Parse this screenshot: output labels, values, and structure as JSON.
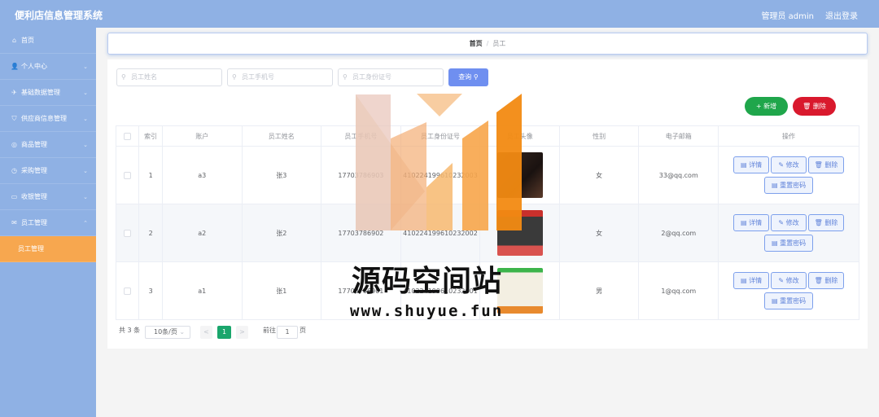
{
  "app": {
    "title": "便利店信息管理系统",
    "user_label": "管理员 admin",
    "logout_label": "退出登录"
  },
  "sidebar": {
    "items": [
      {
        "icon": "home-icon",
        "glyph": "⌂",
        "label": "首页"
      },
      {
        "icon": "user-icon",
        "glyph": "👤",
        "label": "个人中心"
      },
      {
        "icon": "paper-plane-icon",
        "glyph": "✈",
        "label": "基础数据管理"
      },
      {
        "icon": "shield-icon",
        "glyph": "⛉",
        "label": "供应商信息管理"
      },
      {
        "icon": "compass-icon",
        "glyph": "◎",
        "label": "商品管理"
      },
      {
        "icon": "clock-icon",
        "glyph": "◷",
        "label": "采购管理"
      },
      {
        "icon": "card-icon",
        "glyph": "▭",
        "label": "收银管理"
      },
      {
        "icon": "mail-icon",
        "glyph": "✉",
        "label": "员工管理"
      },
      {
        "icon": "",
        "glyph": "",
        "label": "员工管理"
      }
    ]
  },
  "breadcrumb": {
    "home": "首页",
    "separator": "/",
    "current": "员工"
  },
  "search": {
    "name_placeholder": "员工姓名",
    "phone_placeholder": "员工手机号",
    "idcard_placeholder": "员工身份证号",
    "query_label": "查询"
  },
  "actions": {
    "add_label": "新增",
    "delete_label": "删除"
  },
  "table": {
    "headers": [
      "索引",
      "账户",
      "员工姓名",
      "员工手机号",
      "员工身份证号",
      "员工头像",
      "性别",
      "电子邮箱",
      "操作"
    ],
    "rows": [
      {
        "index": "1",
        "account": "a3",
        "name": "张3",
        "phone": "17703786903",
        "idcard": "410224199610232003",
        "gender": "女",
        "email": "33@qq.com"
      },
      {
        "index": "2",
        "account": "a2",
        "name": "张2",
        "phone": "17703786902",
        "idcard": "410224199610232002",
        "gender": "女",
        "email": "2@qq.com"
      },
      {
        "index": "3",
        "account": "a1",
        "name": "张1",
        "phone": "17703786901",
        "idcard": "410224199610232001",
        "gender": "男",
        "email": "1@qq.com"
      }
    ],
    "op_labels": {
      "detail": "详情",
      "edit": "修改",
      "delete": "删除",
      "reset": "重置密码"
    }
  },
  "pager": {
    "total": "共 3 条",
    "page_size": "10条/页",
    "prev": "<",
    "current_page": "1",
    "next": ">",
    "jump_prefix": "前往",
    "jump_value": "1",
    "jump_suffix": "页"
  },
  "watermark": {
    "title": "源码空间站",
    "url": "www.shuyue.fun"
  },
  "colors": {
    "accent": "#8fb1e4",
    "active_menu": "#f7a74f",
    "add_button": "#1fa64b",
    "delete_button": "#d9192d",
    "query_button": "#6f8ff0",
    "current_page": "#1aa66c"
  }
}
